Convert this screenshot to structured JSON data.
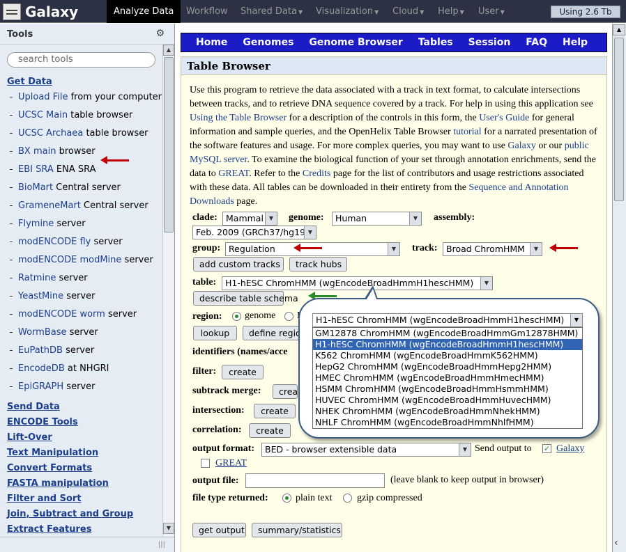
{
  "masthead": {
    "brand": "Galaxy",
    "nav": [
      {
        "label": "Analyze Data",
        "active": true,
        "caret": false
      },
      {
        "label": "Workflow",
        "caret": false
      },
      {
        "label": "Shared Data",
        "caret": true
      },
      {
        "label": "Visualization",
        "caret": true
      },
      {
        "label": "Cloud",
        "caret": true
      },
      {
        "label": "Help",
        "caret": true
      },
      {
        "label": "User",
        "caret": true
      }
    ],
    "usage": "Using 2.6 Tb"
  },
  "tools": {
    "title": "Tools",
    "search_placeholder": "search tools",
    "get_data": "Get Data",
    "items": [
      {
        "link": "Upload File",
        "rest": " from your computer"
      },
      {
        "link": "UCSC Main",
        "rest": " table browser"
      },
      {
        "link": "UCSC Archaea",
        "rest": " table browser"
      },
      {
        "link": "BX main",
        "rest": " browser"
      },
      {
        "link": "EBI SRA",
        "rest": " ENA SRA"
      },
      {
        "link": "BioMart",
        "rest": " Central server"
      },
      {
        "link": "GrameneMart",
        "rest": " Central server"
      },
      {
        "link": "Flymine",
        "rest": " server"
      },
      {
        "link": "modENCODE fly",
        "rest": " server"
      },
      {
        "link": "modENCODE modMine",
        "rest": " server"
      },
      {
        "link": "Ratmine",
        "rest": " server"
      },
      {
        "link": "YeastMine",
        "rest": " server"
      },
      {
        "link": "modENCODE worm",
        "rest": " server"
      },
      {
        "link": "WormBase",
        "rest": " server"
      },
      {
        "link": "EuPathDB",
        "rest": " server"
      },
      {
        "link": "EncodeDB",
        "rest": " at NHGRI"
      },
      {
        "link": "EpiGRAPH",
        "rest": " server"
      }
    ],
    "sections": [
      "Send Data",
      "ENCODE Tools",
      "Lift-Over",
      "Text Manipulation",
      "Convert Formats",
      "FASTA manipulation",
      "Filter and Sort",
      "Join, Subtract and Group",
      "Extract Features"
    ]
  },
  "ucsc_nav": [
    "Home",
    "Genomes",
    "Genome Browser",
    "Tables",
    "Session",
    "FAQ",
    "Help"
  ],
  "table_browser": {
    "title": "Table Browser",
    "intro": [
      {
        "t": "Use this program to retrieve the data associated with a track in text format, to calculate intersections between tracks, and to retrieve DNA sequence covered by a track. For help in using this application see "
      },
      {
        "a": "Using the Table Browser"
      },
      {
        "t": " for a description of the controls in this form, the "
      },
      {
        "a": "User's Guide"
      },
      {
        "t": " for general information and sample queries, and the OpenHelix Table Browser "
      },
      {
        "a": "tutorial"
      },
      {
        "t": " for a narrated presentation of the software features and usage. For more complex queries, you may want to use "
      },
      {
        "a": "Galaxy"
      },
      {
        "t": " or our "
      },
      {
        "a": "public MySQL server"
      },
      {
        "t": ". To examine the biological function of your set through annotation enrichments, send the data to "
      },
      {
        "a": "GREAT"
      },
      {
        "t": ". Refer to the "
      },
      {
        "a": "Credits"
      },
      {
        "t": " page for the list of contributors and usage restrictions associated with these data. All tables can be downloaded in their entirety from the "
      },
      {
        "a": "Sequence and Annotation Downloads"
      },
      {
        "t": " page."
      }
    ],
    "clade_label": "clade:",
    "clade": "Mammal",
    "genome_label": "genome:",
    "genome": "Human",
    "assembly_label": "assembly:",
    "assembly": "Feb. 2009 (GRCh37/hg19)",
    "group_label": "group:",
    "group": "Regulation",
    "track_label": "track:",
    "track": "Broad ChromHMM",
    "add_custom_tracks": "add custom tracks",
    "track_hubs": "track hubs",
    "table_label": "table:",
    "table": "H1-hESC ChromHMM (wgEncodeBroadHmmH1hescHMM)",
    "describe_schema": "describe table schema",
    "region_label": "region:",
    "region_genome": "genome",
    "region_other": "E",
    "lookup": "lookup",
    "define_regions": "define regio",
    "identifiers_label": "identifiers (names/acce",
    "filter_label": "filter:",
    "create": "create",
    "subtrack_label": "subtrack merge:",
    "subtrack_btn": "crea",
    "intersection_label": "intersection:",
    "correlation_label": "correlation:",
    "output_format_label": "output format:",
    "output_format": "BED - browser extensible data",
    "send_output": "Send output to",
    "galaxy": "Galaxy",
    "great": "GREAT",
    "output_file_label": "output file:",
    "output_file_hint": "(leave blank to keep output in browser)",
    "file_type_label": "file type returned:",
    "plain_text": "plain text",
    "gzip": "gzip compressed",
    "get_output": "get output",
    "summary": "summary/statistics"
  },
  "table_dropdown": {
    "selected": "H1-hESC ChromHMM (wgEncodeBroadHmmH1hescHMM)",
    "options": [
      "GM12878 ChromHMM (wgEncodeBroadHmmGm12878HMM)",
      "H1-hESC ChromHMM (wgEncodeBroadHmmH1hescHMM)",
      "K562 ChromHMM (wgEncodeBroadHmmK562HMM)",
      "HepG2 ChromHMM (wgEncodeBroadHmmHepg2HMM)",
      "HMEC ChromHMM (wgEncodeBroadHmmHmecHMM)",
      "HSMM ChromHMM (wgEncodeBroadHmmHsmmHMM)",
      "HUVEC ChromHMM (wgEncodeBroadHmmHuvecHMM)",
      "NHEK ChromHMM (wgEncodeBroadHmmNhekHMM)",
      "NHLF ChromHMM (wgEncodeBroadHmmNhlfHMM)"
    ],
    "highlighted_index": 1
  },
  "colors": {
    "red_arrow": "#c00000",
    "green_arrow": "#2a8a2a",
    "ucsc_nav": "#1b1bc8"
  }
}
